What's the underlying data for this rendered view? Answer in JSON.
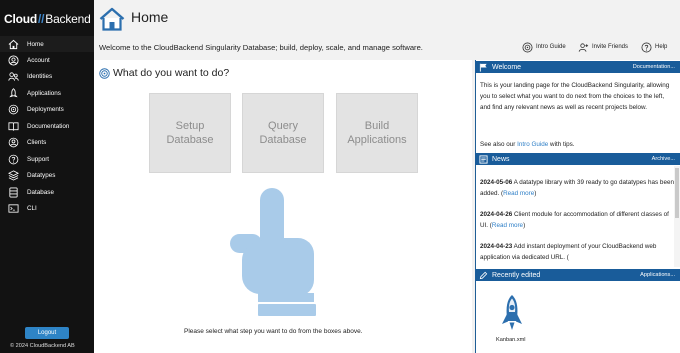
{
  "sidebar": {
    "logo_part1": "Cloud",
    "logo_part2": "Backend",
    "items": [
      {
        "label": "Home",
        "icon": "home-icon"
      },
      {
        "label": "Account",
        "icon": "account-icon"
      },
      {
        "label": "Identities",
        "icon": "identities-icon"
      },
      {
        "label": "Applications",
        "icon": "applications-icon"
      },
      {
        "label": "Deployments",
        "icon": "deployments-icon"
      },
      {
        "label": "Documentation",
        "icon": "documentation-icon"
      },
      {
        "label": "Clients",
        "icon": "clients-icon"
      },
      {
        "label": "Support",
        "icon": "support-icon"
      },
      {
        "label": "Datatypes",
        "icon": "datatypes-icon"
      },
      {
        "label": "Database",
        "icon": "database-icon"
      },
      {
        "label": "CLI",
        "icon": "cli-icon"
      }
    ],
    "logout_label": "Logout",
    "copyright": "© 2024 CloudBackend AB"
  },
  "header": {
    "title": "Home",
    "welcome": "Welcome to the CloudBackend Singularity Database; build, deploy, scale, and manage software.",
    "links": {
      "intro_guide": "Intro Guide",
      "invite_friends": "Invite Friends",
      "help": "Help"
    }
  },
  "main": {
    "prompt": "What do you want to do?",
    "choices": [
      {
        "label": "Setup\nDatabase"
      },
      {
        "label": "Query\nDatabase"
      },
      {
        "label": "Build\nApplications"
      }
    ],
    "instruction": "Please select what step you want to do from the boxes above."
  },
  "welcome_panel": {
    "title": "Welcome",
    "link": "Documentation...",
    "text": "This is your landing page for the CloudBackend Singularity, allowing you to select what you want to do next from the choices to the left, and find any relevant news as well as recent projects below.",
    "see_also_prefix": "See also our ",
    "see_also_link": "Intro Guide",
    "see_also_suffix": " with tips."
  },
  "news_panel": {
    "title": "News",
    "link": "Archive...",
    "items": [
      {
        "date": "2024-05-06",
        "text": " A datatype library with 39 ready to go datatypes has been added. (",
        "more": "Read more",
        "tail": ")"
      },
      {
        "date": "2024-04-26",
        "text": " Client module for accommodation of different classes of UI. (",
        "more": "Read more",
        "tail": ")"
      },
      {
        "date": "2024-04-23",
        "text": " Add instant deployment of your CloudBackend web application via dedicated URL. (",
        "more": "",
        "tail": ""
      }
    ]
  },
  "recent_panel": {
    "title": "Recently edited",
    "link": "Applications...",
    "items": [
      {
        "label": "Kanban.xml",
        "icon": "rocket-icon"
      }
    ]
  },
  "colors": {
    "sidebar_bg": "#121212",
    "accent_blue": "#195c9a",
    "link_blue": "#2e7fc7",
    "hand_blue": "#a9cbe9",
    "choice_bg": "#e3e3e3"
  }
}
